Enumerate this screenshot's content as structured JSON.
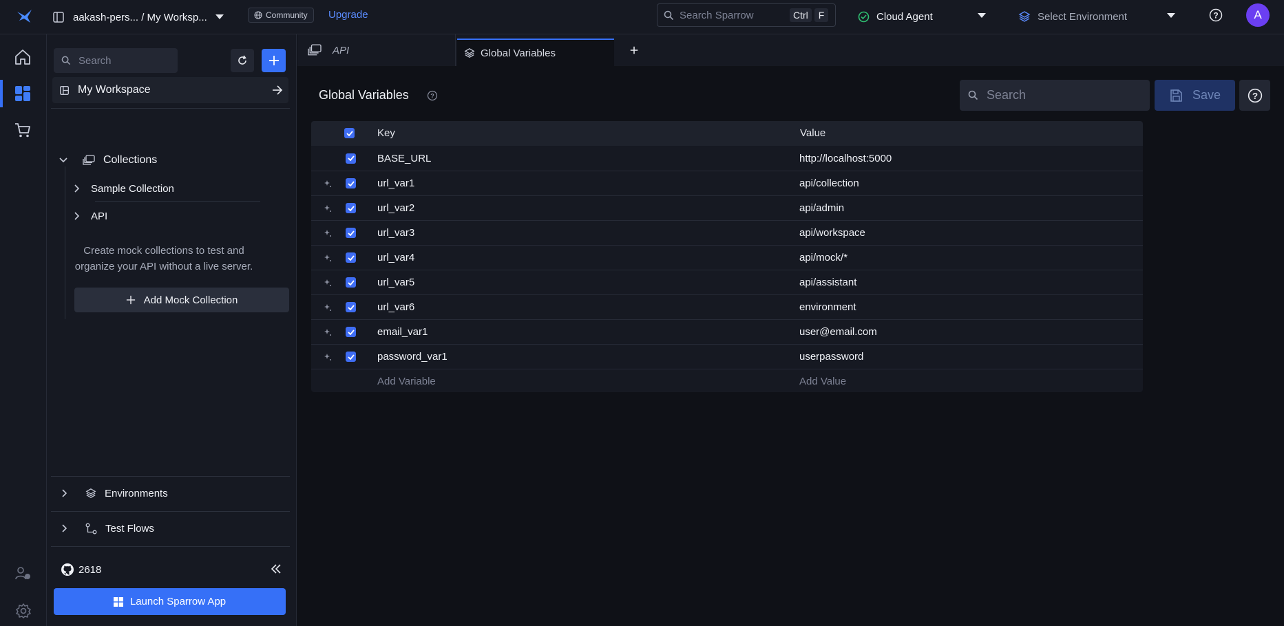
{
  "topbar": {
    "workspace_path": "aakash-pers... / My Worksp...",
    "community_label": "Community",
    "upgrade_label": "Upgrade",
    "search_placeholder": "Search Sparrow",
    "search_shortcut_ctrl": "Ctrl",
    "search_shortcut_key": "F",
    "agent_label": "Cloud Agent",
    "environment_label": "Select Environment",
    "avatar_initial": "A"
  },
  "sidebar": {
    "search_placeholder": "Search",
    "workspace_label": "My Workspace",
    "collections_label": "Collections",
    "items": [
      {
        "label": "Sample Collection"
      },
      {
        "label": "API"
      }
    ],
    "mock_hint_line1": "Create mock collections to test and",
    "mock_hint_line2": "organize your API without a live server.",
    "add_mock_label": "Add Mock Collection",
    "environments_label": "Environments",
    "test_flows_label": "Test Flows",
    "github_stars": "2618",
    "launch_app_label": "Launch Sparrow App"
  },
  "tabs": [
    {
      "label": "API",
      "active": false
    },
    {
      "label": "Global Variables",
      "active": true
    }
  ],
  "globals": {
    "title": "Global Variables",
    "search_placeholder": "Search",
    "save_label": "Save",
    "columns": {
      "key": "Key",
      "value": "Value"
    },
    "rows": [
      {
        "key": "BASE_URL",
        "value": "http://localhost:5000"
      },
      {
        "key": "url_var1",
        "value": "api/collection"
      },
      {
        "key": "url_var2",
        "value": "api/admin"
      },
      {
        "key": "url_var3",
        "value": "api/workspace"
      },
      {
        "key": "url_var4",
        "value": "api/mock/*"
      },
      {
        "key": "url_var5",
        "value": "api/assistant"
      },
      {
        "key": "url_var6",
        "value": "environment"
      },
      {
        "key": "email_var1",
        "value": "user@email.com"
      },
      {
        "key": "password_var1",
        "value": "userpassword"
      }
    ],
    "add_key_placeholder": "Add Variable",
    "add_value_placeholder": "Add Value"
  },
  "colors": {
    "accent": "#3670f7",
    "background": "#0f1117",
    "panel": "#161922",
    "success": "#2fbf71"
  }
}
